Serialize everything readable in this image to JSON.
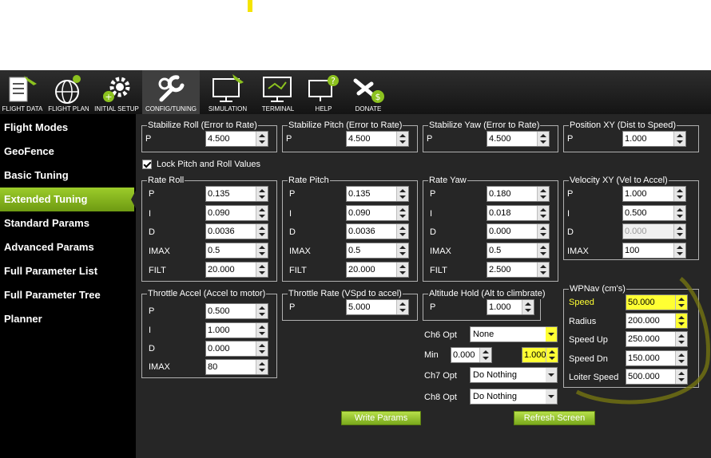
{
  "toolbar": {
    "buttons": [
      {
        "label": "FLIGHT DATA"
      },
      {
        "label": "FLIGHT PLAN"
      },
      {
        "label": "INITIAL SETUP"
      },
      {
        "label": "CONFIG/TUNING"
      },
      {
        "label": "SIMULATION"
      },
      {
        "label": "TERMINAL"
      },
      {
        "label": "HELP"
      },
      {
        "label": "DONATE"
      }
    ]
  },
  "sidebar": {
    "items": [
      {
        "label": "Flight Modes"
      },
      {
        "label": "GeoFence"
      },
      {
        "label": "Basic Tuning"
      },
      {
        "label": "Extended Tuning"
      },
      {
        "label": "Standard Params"
      },
      {
        "label": "Advanced Params"
      },
      {
        "label": "Full Parameter List"
      },
      {
        "label": "Full Parameter Tree"
      },
      {
        "label": "Planner"
      }
    ]
  },
  "stab_roll": {
    "title": "Stabilize Roll (Error to Rate)",
    "p_label": "P",
    "p": "4.500"
  },
  "stab_pitch": {
    "title": "Stabilize Pitch (Error to Rate)",
    "p_label": "P",
    "p": "4.500"
  },
  "stab_yaw": {
    "title": "Stabilize Yaw (Error to Rate)",
    "p_label": "P",
    "p": "4.500"
  },
  "pos_xy": {
    "title": "Position XY (Dist to Speed)",
    "p_label": "P",
    "p": "1.000"
  },
  "lock_pitch_roll": {
    "label": "Lock Pitch and Roll Values",
    "checked": true
  },
  "rate_roll": {
    "title": "Rate Roll",
    "labels": [
      "P",
      "I",
      "D",
      "IMAX",
      "FILT"
    ],
    "values": [
      "0.135",
      "0.090",
      "0.0036",
      "0.5",
      "20.000"
    ]
  },
  "rate_pitch": {
    "title": "Rate Pitch",
    "labels": [
      "P",
      "I",
      "D",
      "IMAX",
      "FILT"
    ],
    "values": [
      "0.135",
      "0.090",
      "0.0036",
      "0.5",
      "20.000"
    ]
  },
  "rate_yaw": {
    "title": "Rate Yaw",
    "labels": [
      "P",
      "I",
      "D",
      "IMAX",
      "FILT"
    ],
    "values": [
      "0.180",
      "0.018",
      "0.000",
      "0.5",
      "2.500"
    ]
  },
  "vel_xy": {
    "title": "Velocity XY (Vel to Accel)",
    "labels": [
      "P",
      "I",
      "D",
      "IMAX"
    ],
    "values": [
      "1.000",
      "0.500",
      "0.000",
      "100"
    ]
  },
  "thr_accel": {
    "title": "Throttle Accel (Accel to motor)",
    "labels": [
      "P",
      "I",
      "D",
      "IMAX"
    ],
    "values": [
      "0.500",
      "1.000",
      "0.000",
      "80"
    ]
  },
  "thr_rate": {
    "title": "Throttle Rate (VSpd to accel)",
    "p_label": "P",
    "p": "5.000"
  },
  "alt_hold": {
    "title": "Altitude Hold (Alt to climbrate)",
    "p_label": "P",
    "p": "1.000"
  },
  "wpnav": {
    "title": "WPNav (cm's)",
    "labels": [
      "Speed",
      "Radius",
      "Speed Up",
      "Speed Dn",
      "Loiter Speed"
    ],
    "values": [
      "50.000",
      "200.000",
      "250.000",
      "150.000",
      "500.000"
    ]
  },
  "ch6": {
    "label": "Ch6 Opt",
    "value": "None",
    "min_label": "Min",
    "min": "0.000",
    "max": "1.000"
  },
  "ch7": {
    "label": "Ch7 Opt",
    "value": "Do Nothing"
  },
  "ch8": {
    "label": "Ch8 Opt",
    "value": "Do Nothing"
  },
  "actions": {
    "write": "Write Params",
    "refresh": "Refresh Screen"
  },
  "colors": {
    "accent": "#8cc21f",
    "highlight": "#ffff33",
    "panel": "#262626",
    "sidebar": "#000000"
  }
}
